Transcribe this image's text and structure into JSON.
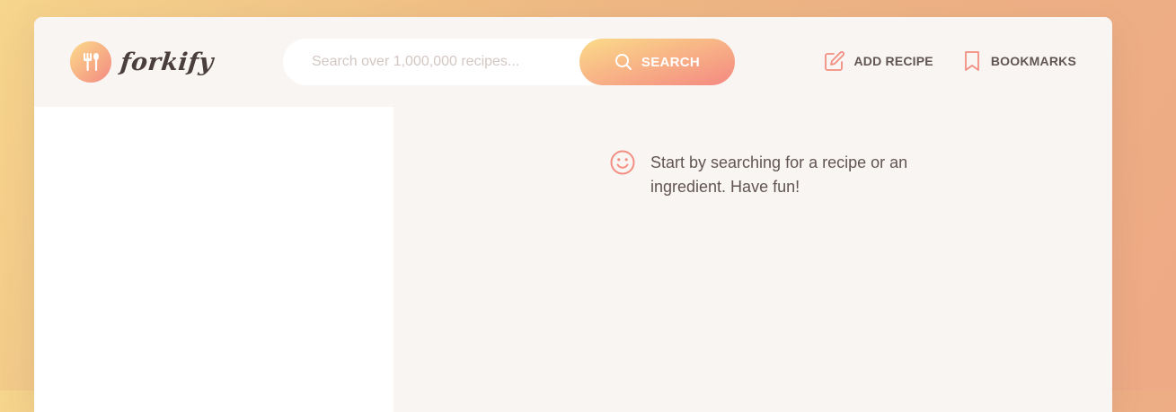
{
  "brand": {
    "logo_text": "forkify",
    "accent_start": "#fbdb89",
    "accent_end": "#f48982",
    "logo_icon": "fork-spoon-icon"
  },
  "search": {
    "placeholder": "Search over 1,000,000 recipes...",
    "value": "",
    "button_label": "SEARCH",
    "button_icon": "search-icon"
  },
  "nav": {
    "add_recipe_label": "ADD RECIPE",
    "add_recipe_icon": "edit-icon",
    "bookmarks_label": "BOOKMARKS",
    "bookmarks_icon": "bookmark-icon"
  },
  "recipe": {
    "message": "Start by searching for a recipe or an ingredient. Have fun!",
    "message_icon": "smile-icon"
  }
}
